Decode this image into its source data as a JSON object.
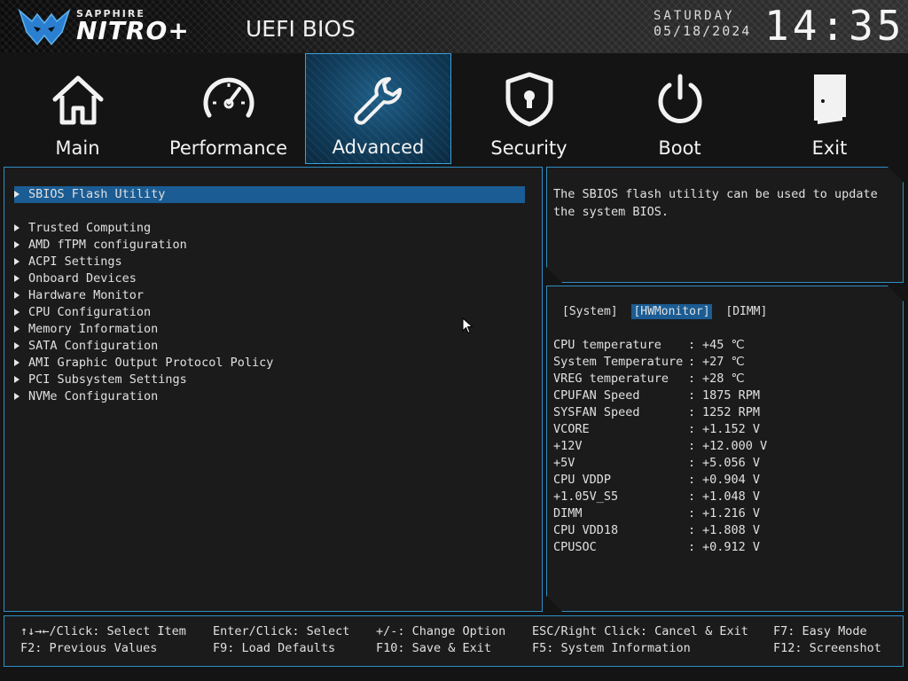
{
  "header": {
    "brand_small": "SAPPHIRE",
    "brand_big": "NITRO+",
    "title": "UEFI BIOS",
    "day": "SATURDAY",
    "date": "05/18/2024",
    "time": "14:35"
  },
  "tabs": [
    {
      "label": "Main",
      "icon": "home-icon"
    },
    {
      "label": "Performance",
      "icon": "speedometer-icon"
    },
    {
      "label": "Advanced",
      "icon": "wrench-icon",
      "active": true
    },
    {
      "label": "Security",
      "icon": "shield-lock-icon"
    },
    {
      "label": "Boot",
      "icon": "power-icon"
    },
    {
      "label": "Exit",
      "icon": "door-icon"
    }
  ],
  "menu": {
    "selected": "SBIOS Flash Utility",
    "items": [
      "SBIOS Flash Utility",
      "Trusted Computing",
      "AMD fTPM configuration",
      "ACPI Settings",
      "Onboard Devices",
      "Hardware Monitor",
      "CPU Configuration",
      "Memory Information",
      "SATA Configuration",
      "AMI Graphic Output Protocol Policy",
      "PCI Subsystem Settings",
      "NVMe Configuration"
    ]
  },
  "help": {
    "text": "The SBIOS flash utility can be used to update the system BIOS."
  },
  "hwmonitor": {
    "tabs": [
      "[System]",
      "[HWMonitor]",
      "[DIMM]"
    ],
    "active_tab": "[HWMonitor]",
    "rows": [
      {
        "name": "CPU temperature",
        "value": "+45 ℃"
      },
      {
        "name": "System Temperature",
        "value": "+27 ℃"
      },
      {
        "name": "VREG temperature",
        "value": "+28 ℃"
      },
      {
        "name": "CPUFAN Speed",
        "value": "1875 RPM"
      },
      {
        "name": "SYSFAN Speed",
        "value": "1252 RPM"
      },
      {
        "name": "VCORE",
        "value": "+1.152 V"
      },
      {
        "name": "+12V",
        "value": "+12.000 V"
      },
      {
        "name": "+5V",
        "value": "+5.056 V"
      },
      {
        "name": "CPU VDDP",
        "value": "+0.904 V"
      },
      {
        "name": "+1.05V_S5",
        "value": "+1.048 V"
      },
      {
        "name": "DIMM",
        "value": "+1.216 V"
      },
      {
        "name": "CPU VDD18",
        "value": "+1.808 V"
      },
      {
        "name": "CPUSOC",
        "value": "+0.912 V"
      }
    ]
  },
  "footer": {
    "row1": [
      "↑↓→←/Click: Select Item",
      "Enter/Click: Select",
      "+/-: Change Option",
      "ESC/Right Click: Cancel & Exit",
      "F7: Easy Mode"
    ],
    "row2": [
      "F2: Previous Values",
      "F9: Load Defaults",
      "F10: Save & Exit",
      "F5: System Information",
      "F12: Screenshot"
    ]
  },
  "colors": {
    "accent": "#2f8fc6",
    "selection": "#1a5c93",
    "background": "#141414"
  }
}
